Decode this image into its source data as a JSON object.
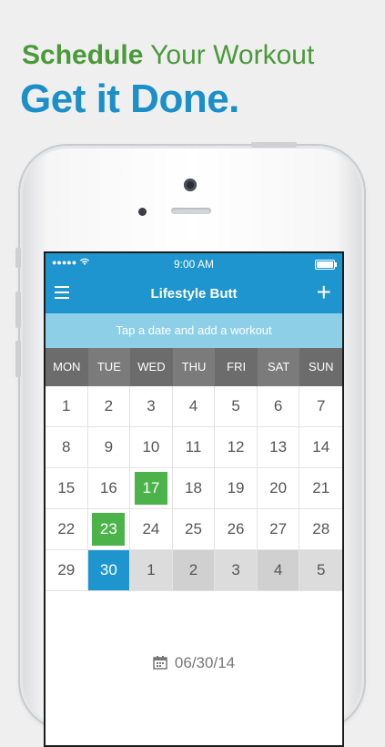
{
  "promo": {
    "headline_bold": "Schedule",
    "headline_rest": "Your Workout",
    "subhead": "Get it Done."
  },
  "status": {
    "time": "9:00 AM"
  },
  "nav": {
    "title": "Lifestyle Butt",
    "add_label": "+"
  },
  "hint": "Tap a date and add a workout",
  "weekdays": [
    "MON",
    "TUE",
    "WED",
    "THU",
    "FRI",
    "SAT",
    "SUN"
  ],
  "calendar": {
    "rows": [
      [
        "1",
        "2",
        "3",
        "4",
        "5",
        "6",
        "7"
      ],
      [
        "8",
        "9",
        "10",
        "11",
        "12",
        "13",
        "14"
      ],
      [
        "15",
        "16",
        "17",
        "18",
        "19",
        "20",
        "21"
      ],
      [
        "22",
        "23",
        "24",
        "25",
        "26",
        "27",
        "28"
      ],
      [
        "29",
        "30",
        "1",
        "2",
        "3",
        "4",
        "5"
      ]
    ],
    "workout_days": [
      "17",
      "23"
    ],
    "today": "30",
    "workout_color": "#4cb34a",
    "today_color": "#1f95cf"
  },
  "selected_date": "06/30/14",
  "icons": {
    "menu": "menu-icon",
    "add": "plus-icon",
    "calendar": "calendar-icon",
    "wifi": "wifi-icon",
    "battery": "battery-icon"
  }
}
